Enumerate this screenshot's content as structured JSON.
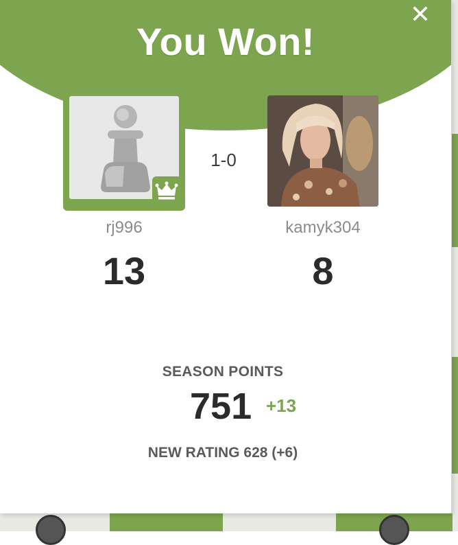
{
  "dialog": {
    "title": "You Won!",
    "close_icon": "close-icon",
    "accent_color": "#7da54f"
  },
  "game": {
    "result": "1-0",
    "player": {
      "username": "rj996",
      "score": "13",
      "avatar_icon": "pawn-icon",
      "badge_icon": "crown-icon"
    },
    "opponent": {
      "username": "kamyk304",
      "score": "8",
      "avatar_icon": "user-photo"
    }
  },
  "season": {
    "label": "SEASON POINTS",
    "points": "751",
    "delta": "+13"
  },
  "rating": {
    "text": "NEW RATING 628 (+6)"
  }
}
